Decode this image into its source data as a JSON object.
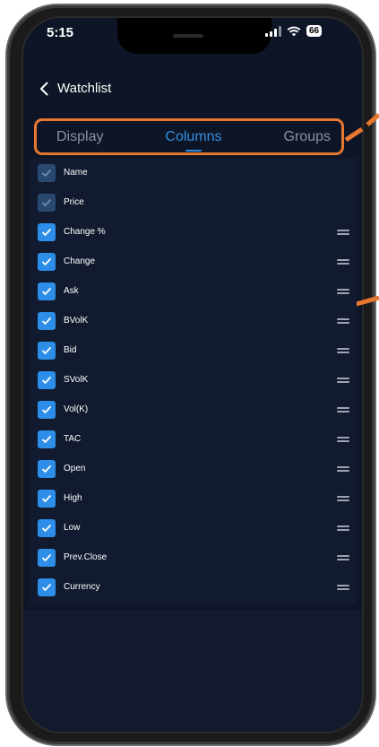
{
  "status_bar": {
    "time": "5:15",
    "battery": "66"
  },
  "header": {
    "back_label": "Watchlist"
  },
  "tabs": [
    {
      "label": "Display",
      "active": false
    },
    {
      "label": "Columns",
      "active": true
    },
    {
      "label": "Groups",
      "active": false
    }
  ],
  "columns": [
    {
      "label": "Name",
      "checked": true,
      "locked": true
    },
    {
      "label": "Price",
      "checked": true,
      "locked": true
    },
    {
      "label": "Change %",
      "checked": true,
      "locked": false
    },
    {
      "label": "Change",
      "checked": true,
      "locked": false
    },
    {
      "label": "Ask",
      "checked": true,
      "locked": false
    },
    {
      "label": "BVolK",
      "checked": true,
      "locked": false
    },
    {
      "label": "Bid",
      "checked": true,
      "locked": false
    },
    {
      "label": "SVolK",
      "checked": true,
      "locked": false
    },
    {
      "label": "Vol(K)",
      "checked": true,
      "locked": false
    },
    {
      "label": "TAC",
      "checked": true,
      "locked": false
    },
    {
      "label": "Open",
      "checked": true,
      "locked": false
    },
    {
      "label": "High",
      "checked": true,
      "locked": false
    },
    {
      "label": "Low",
      "checked": true,
      "locked": false
    },
    {
      "label": "Prev.Close",
      "checked": true,
      "locked": false
    },
    {
      "label": "Currency",
      "checked": true,
      "locked": false
    }
  ],
  "colors": {
    "accent": "#2c8ee8",
    "highlight": "#e87730",
    "background": "#0e1526"
  },
  "icons": [
    "chevron-left-icon",
    "signal-icon",
    "wifi-icon",
    "battery-icon",
    "checkmark-icon",
    "drag-handle-icon"
  ]
}
